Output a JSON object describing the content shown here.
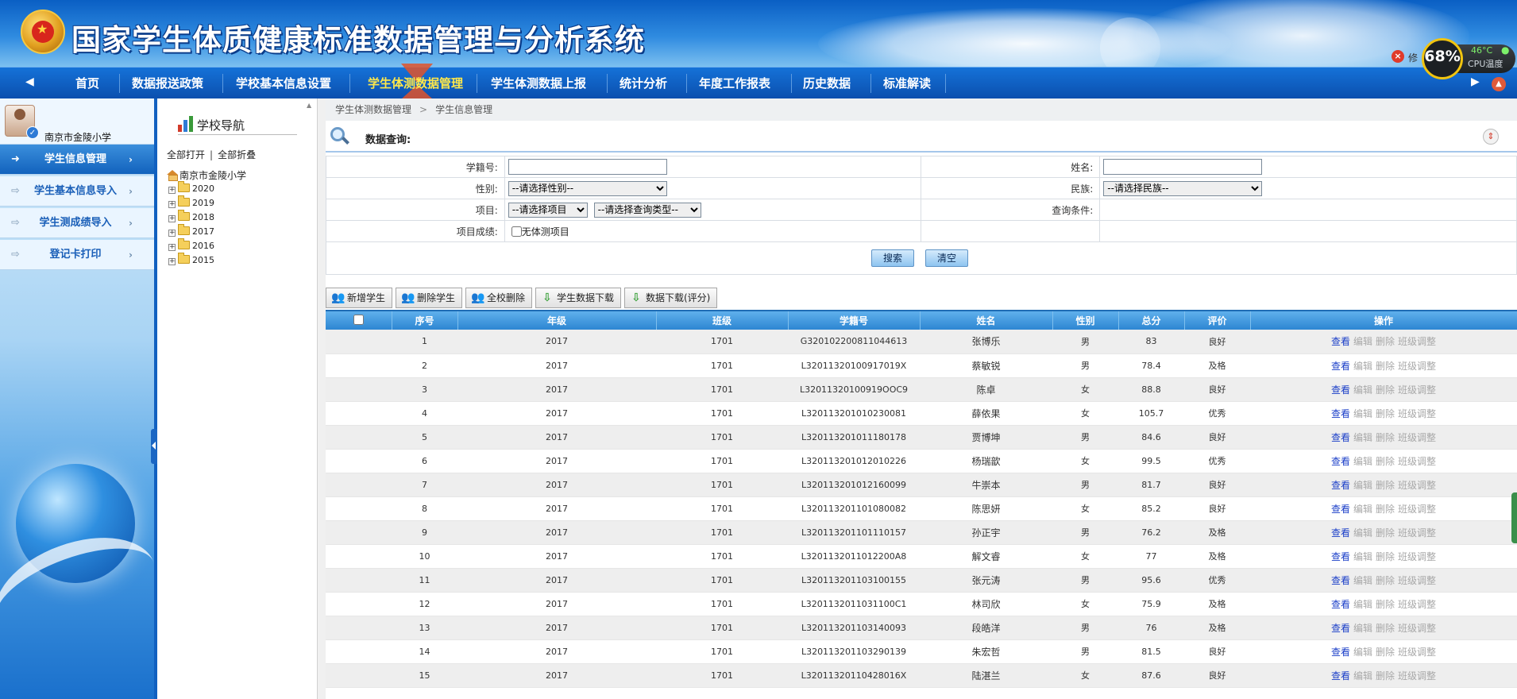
{
  "header": {
    "system_title": "国家学生体质健康标准数据管理与分析系统",
    "logout_text": "修"
  },
  "cpu_widget": {
    "percent": "68%",
    "temperature": "46°C",
    "label": "CPU温度"
  },
  "nav": {
    "items": [
      "首页",
      "数据报送政策",
      "学校基本信息设置",
      "学生体测数据管理",
      "学生体测数据上报",
      "统计分析",
      "年度工作报表",
      "历史数据",
      "标准解读"
    ],
    "active_index": 3
  },
  "sidebar": {
    "school_name": "南京市金陵小学",
    "items": [
      {
        "label": "学生信息管理",
        "active": true
      },
      {
        "label": "学生基本信息导入",
        "active": false
      },
      {
        "label": "学生测成绩导入",
        "active": false
      },
      {
        "label": "登记卡打印",
        "active": false
      }
    ]
  },
  "tree": {
    "title": "学校导航",
    "expand_all": "全部打开",
    "collapse_all": "全部折叠",
    "root": "南京市金陵小学",
    "nodes": [
      "2020",
      "2019",
      "2018",
      "2017",
      "2016",
      "2015"
    ]
  },
  "breadcrumb": {
    "level1": "学生体测数据管理",
    "level2": "学生信息管理"
  },
  "query": {
    "title": "数据查询:",
    "student_id_label": "学籍号:",
    "name_label": "姓名:",
    "gender_label": "性别:",
    "gender_placeholder": "--请选择性别--",
    "ethnicity_label": "民族:",
    "ethnicity_placeholder": "--请选择民族--",
    "item_label": "项目:",
    "item_placeholder": "--请选择项目",
    "query_type_placeholder": "--请选择查询类型--",
    "condition_label": "查询条件:",
    "score_label": "项目成绩:",
    "no_test_label": "无体测项目",
    "search_button": "搜索",
    "clear_button": "清空"
  },
  "toolbar": {
    "add_student": "新增学生",
    "delete_student": "删除学生",
    "delete_all": "全校删除",
    "download_student": "学生数据下载",
    "download_data": "数据下载(评分)"
  },
  "table": {
    "columns": [
      "序号",
      "年级",
      "班级",
      "学籍号",
      "姓名",
      "性别",
      "总分",
      "评价",
      "操作"
    ],
    "ops": {
      "view": "查看",
      "edit": "编辑",
      "delete": "删除",
      "adjust": "班级调整"
    },
    "rows": [
      [
        "1",
        "2017",
        "1701",
        "G320102200811044613",
        "张博乐",
        "男",
        "83",
        "良好"
      ],
      [
        "2",
        "2017",
        "1701",
        "L32011320100917019X",
        "蔡敏锐",
        "男",
        "78.4",
        "及格"
      ],
      [
        "3",
        "2017",
        "1701",
        "L32011320100919OOC9",
        "陈卓",
        "女",
        "88.8",
        "良好"
      ],
      [
        "4",
        "2017",
        "1701",
        "L320113201010230081",
        "薛依果",
        "女",
        "105.7",
        "优秀"
      ],
      [
        "5",
        "2017",
        "1701",
        "L320113201011180178",
        "贾博坤",
        "男",
        "84.6",
        "良好"
      ],
      [
        "6",
        "2017",
        "1701",
        "L320113201012010226",
        "杨瑞歆",
        "女",
        "99.5",
        "优秀"
      ],
      [
        "7",
        "2017",
        "1701",
        "L320113201012160099",
        "牛崇本",
        "男",
        "81.7",
        "良好"
      ],
      [
        "8",
        "2017",
        "1701",
        "L320113201101080082",
        "陈思妍",
        "女",
        "85.2",
        "良好"
      ],
      [
        "9",
        "2017",
        "1701",
        "L320113201101110157",
        "孙正宇",
        "男",
        "76.2",
        "及格"
      ],
      [
        "10",
        "2017",
        "1701",
        "L3201132011012200A8",
        "解文睿",
        "女",
        "77",
        "及格"
      ],
      [
        "11",
        "2017",
        "1701",
        "L320113201103100155",
        "张元涛",
        "男",
        "95.6",
        "优秀"
      ],
      [
        "12",
        "2017",
        "1701",
        "L3201132011031100C1",
        "林司欣",
        "女",
        "75.9",
        "及格"
      ],
      [
        "13",
        "2017",
        "1701",
        "L320113201103140093",
        "段皓洋",
        "男",
        "76",
        "及格"
      ],
      [
        "14",
        "2017",
        "1701",
        "L320113201103290139",
        "朱宏哲",
        "男",
        "81.5",
        "良好"
      ],
      [
        "15",
        "2017",
        "1701",
        "L32011320110428016X",
        "陆湛兰",
        "女",
        "87.6",
        "良好"
      ]
    ]
  }
}
